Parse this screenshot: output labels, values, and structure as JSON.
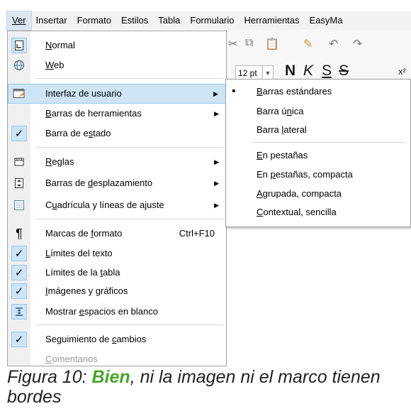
{
  "menubar": {
    "items": [
      {
        "label": "Ver",
        "active": true
      },
      {
        "label": "Insertar"
      },
      {
        "label": "Formato"
      },
      {
        "label": "Estilos"
      },
      {
        "label": "Tabla"
      },
      {
        "label": "Formulario"
      },
      {
        "label": "Herramientas"
      },
      {
        "label": "EasyMa"
      }
    ]
  },
  "toolbar": {
    "font_size": "12 pt",
    "bold": "N",
    "italic": "K",
    "underline": "S",
    "strike": "S",
    "superscript": "x²"
  },
  "view_menu": {
    "items": [
      {
        "label": "Normal",
        "icon": "normal-view-icon",
        "checked": true
      },
      {
        "label": "Web",
        "icon": "globe-icon"
      },
      {
        "label": "Interfaz de usuario",
        "icon": "user-interface-icon",
        "submenu": true,
        "highlighted": true
      },
      {
        "label": "Barras de herramientas",
        "submenu": true
      },
      {
        "label": "Barra de estado",
        "icon": "checkmark-icon",
        "checked": true
      },
      {
        "label": "Reglas",
        "icon": "rulers-icon",
        "submenu": true
      },
      {
        "label": "Barras de desplazamiento",
        "icon": "scrollbars-icon",
        "submenu": true
      },
      {
        "label": "Cuadrícula y líneas de ajuste",
        "icon": "grid-icon",
        "submenu": true
      },
      {
        "label": "Marcas de formato",
        "icon": "pilcrow-icon",
        "shortcut": "Ctrl+F10"
      },
      {
        "label": "Límites del texto",
        "icon": "checkmark-icon",
        "checked": true
      },
      {
        "label": "Límites de la tabla",
        "icon": "checkmark-icon",
        "checked": true
      },
      {
        "label": "Imágenes y gráficos",
        "icon": "checkmark-icon",
        "checked": true
      },
      {
        "label": "Mostrar espacios en blanco",
        "icon": "whitespace-icon",
        "checked": true
      },
      {
        "label": "Seguimiento de cambios",
        "icon": "checkmark-icon",
        "checked": true
      },
      {
        "label": "Comentarios",
        "disabled": true
      }
    ]
  },
  "ui_submenu": {
    "items": [
      {
        "label": "Barras estándares",
        "selected": true
      },
      {
        "label": "Barra única"
      },
      {
        "label": "Barra lateral"
      },
      {
        "label": "En pestañas"
      },
      {
        "label": "En pestañas, compacta"
      },
      {
        "label": "Agrupada, compacta"
      },
      {
        "label": "Contextual, sencilla"
      }
    ]
  },
  "caption": {
    "prefix": "Figura 10: ",
    "emphasis": "Bien",
    "rest": ", ni la imagen ni el marco tienen bordes"
  },
  "colors": {
    "highlight": "#cde5f7",
    "highlight_border": "#99c9ec",
    "caption_emphasis": "#4aa32a"
  }
}
